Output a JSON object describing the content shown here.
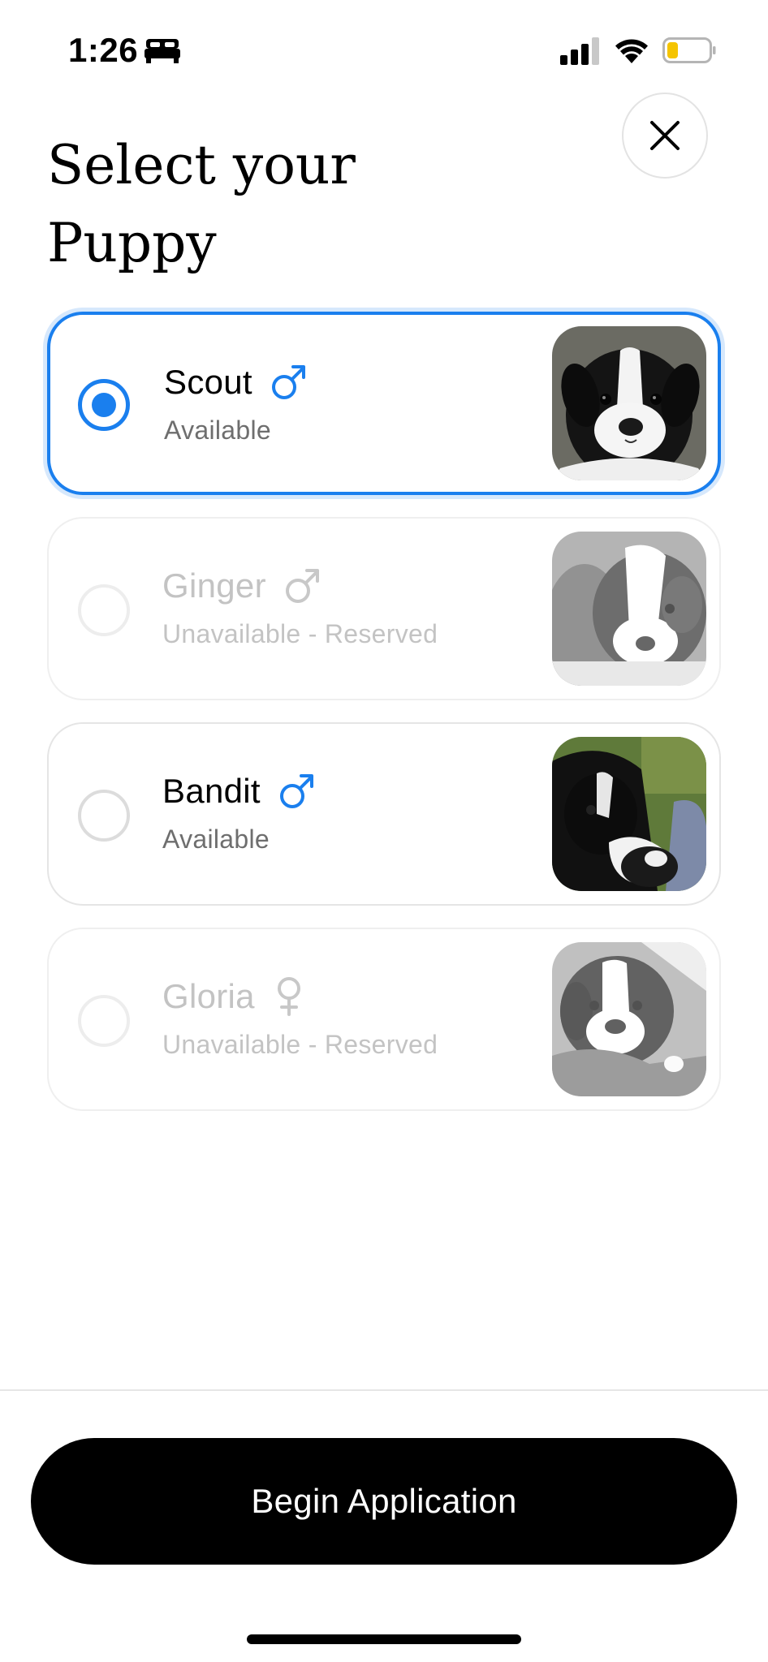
{
  "status_bar": {
    "time": "1:26",
    "bed_icon": "bed-icon",
    "signal_icon": "cellular-signal-icon",
    "wifi_icon": "wifi-icon",
    "battery_icon": "battery-icon",
    "battery_level": 0.25,
    "battery_color": "#f5c400"
  },
  "header": {
    "close_icon": "close-icon",
    "title_line1": "Select your",
    "title_line2": "Puppy"
  },
  "colors": {
    "accent": "#1a7fee",
    "unavailable_text": "#c3c3c3",
    "secondary_text": "#6e6e6e",
    "button_bg": "#000000",
    "button_text": "#ffffff"
  },
  "puppies": [
    {
      "name": "Scout",
      "gender": "male",
      "gender_icon": "male-icon",
      "status": "Available",
      "selected": true,
      "available": true
    },
    {
      "name": "Ginger",
      "gender": "male",
      "gender_icon": "male-icon",
      "status": "Unavailable - Reserved",
      "selected": false,
      "available": false
    },
    {
      "name": "Bandit",
      "gender": "male",
      "gender_icon": "male-icon",
      "status": "Available",
      "selected": false,
      "available": true
    },
    {
      "name": "Gloria",
      "gender": "female",
      "gender_icon": "female-icon",
      "status": "Unavailable - Reserved",
      "selected": false,
      "available": false
    }
  ],
  "footer": {
    "cta_label": "Begin Application"
  }
}
